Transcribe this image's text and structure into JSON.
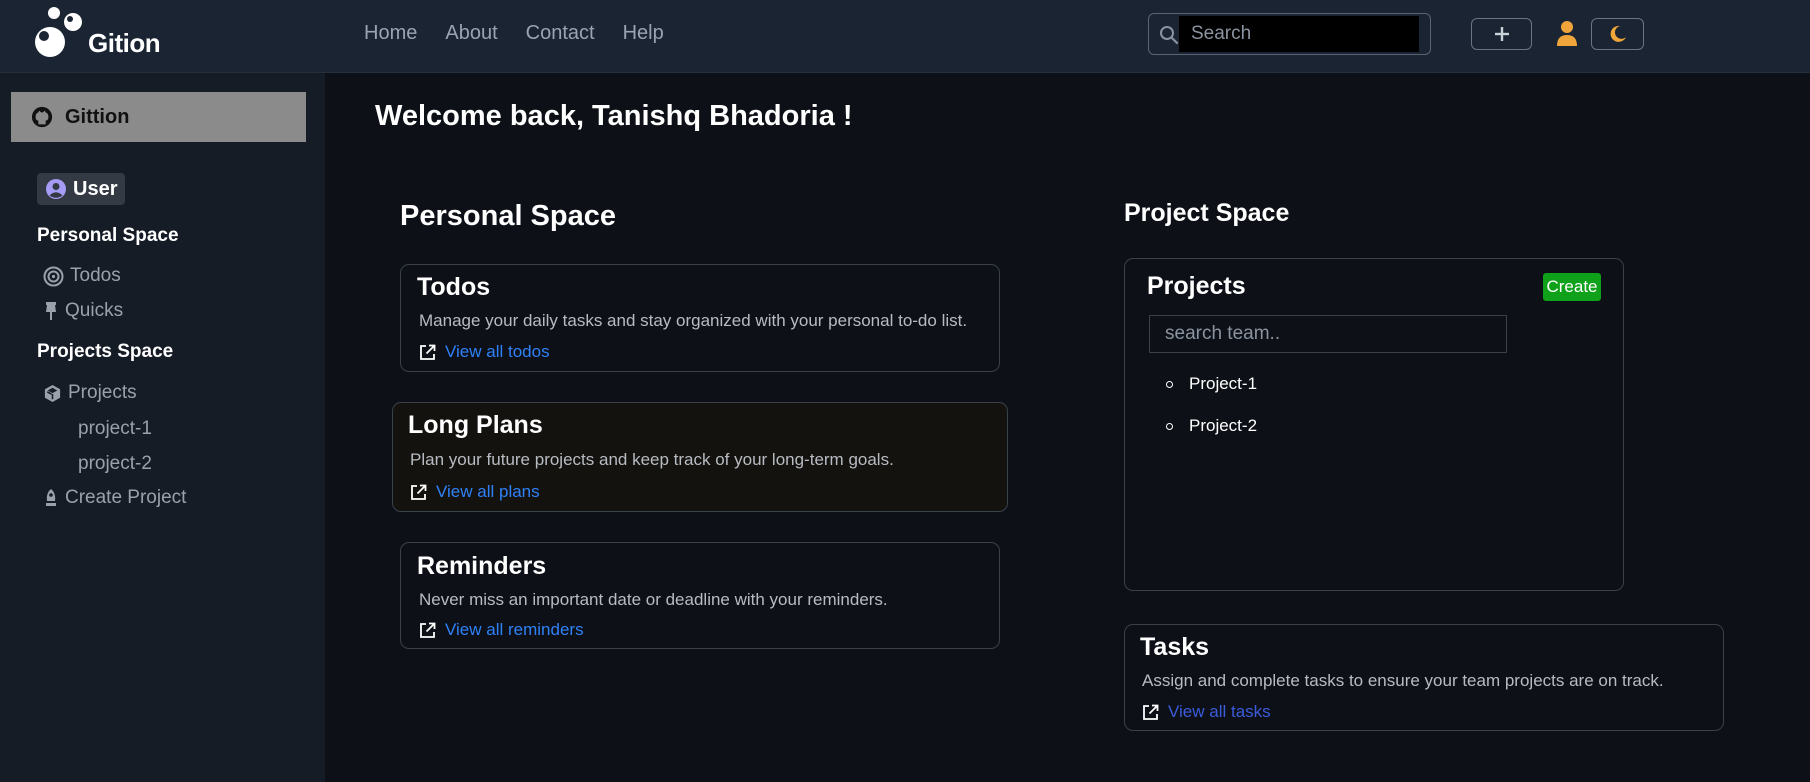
{
  "brand": {
    "name": "Gition"
  },
  "nav": {
    "links": [
      "Home",
      "About",
      "Contact",
      "Help"
    ]
  },
  "search": {
    "placeholder": "Search"
  },
  "sidebar": {
    "brand_label": "Gittion",
    "user_label": "User",
    "personal_heading": "Personal Space",
    "todos_label": "Todos",
    "quicks_label": "Quicks",
    "projects_heading": "Projects Space",
    "projects_label": "Projects",
    "project_links": [
      "project-1",
      "project-2"
    ],
    "create_project_label": "Create Project"
  },
  "main": {
    "welcome": "Welcome back, Tanishq Bhadoria !",
    "personal_title": "Personal Space",
    "project_title": "Project Space",
    "cards": {
      "todos": {
        "title": "Todos",
        "desc": "Manage your daily tasks and stay organized with your personal to-do list.",
        "link": "View all todos"
      },
      "plans": {
        "title": "Long Plans",
        "desc": "Plan your future projects and keep track of your long-term goals.",
        "link": "View all plans"
      },
      "reminders": {
        "title": "Reminders",
        "desc": "Never miss an important date or deadline with your reminders.",
        "link": "View all reminders"
      },
      "tasks": {
        "title": "Tasks",
        "desc": "Assign and complete tasks to ensure your team projects are on track.",
        "link": "View all tasks"
      }
    },
    "projects_panel": {
      "title": "Projects",
      "create_label": "Create",
      "search_placeholder": "search team..",
      "items": [
        "Project-1",
        "Project-2"
      ]
    }
  },
  "colors": {
    "background": "#0d1117",
    "navbar": "#1a2433",
    "sidebar": "#161c26",
    "link_blue": "#2f81f7",
    "link_purple": "#3b5bdb",
    "create_green": "#10a11a",
    "accent_orange": "#f0a53a"
  },
  "icons": [
    "magnifier-icon",
    "plus-icon",
    "user-avatar-icon",
    "moon-icon",
    "github-icon",
    "user-circle-icon",
    "target-icon",
    "pin-icon",
    "cube-icon",
    "rocket-icon",
    "external-link-icon"
  ]
}
